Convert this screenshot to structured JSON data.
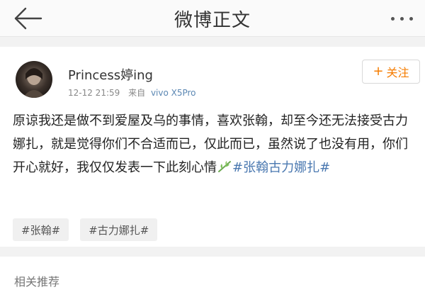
{
  "nav": {
    "back_icon": "arrow-left-icon",
    "title": "微博正文",
    "more_icon": "more-dots-icon"
  },
  "post": {
    "avatar_icon": "user-avatar",
    "username": "Princess婷ing",
    "time": "12-12 21:59",
    "from_label": "来自",
    "device": "vivo X5Pro",
    "follow_button": {
      "plus": "+",
      "label": "关注",
      "color": "#f57c00"
    },
    "content": {
      "text": "原谅我还是做不到爱屋及乌的事情，喜欢张翰，却至今还无法接受古力娜扎，就是觉得你们不合适而已，仅此而已，虽然说了也没有用，你们开心就好，我仅仅发表一下此刻心情",
      "emoji_icon": "bamboo-emoji-icon",
      "topic": "#张翰古力娜扎#",
      "topic_color": "#4a78b0"
    },
    "tags": [
      "#张翰#",
      "#古力娜扎#"
    ]
  },
  "recommend": {
    "title": "相关推荐"
  }
}
